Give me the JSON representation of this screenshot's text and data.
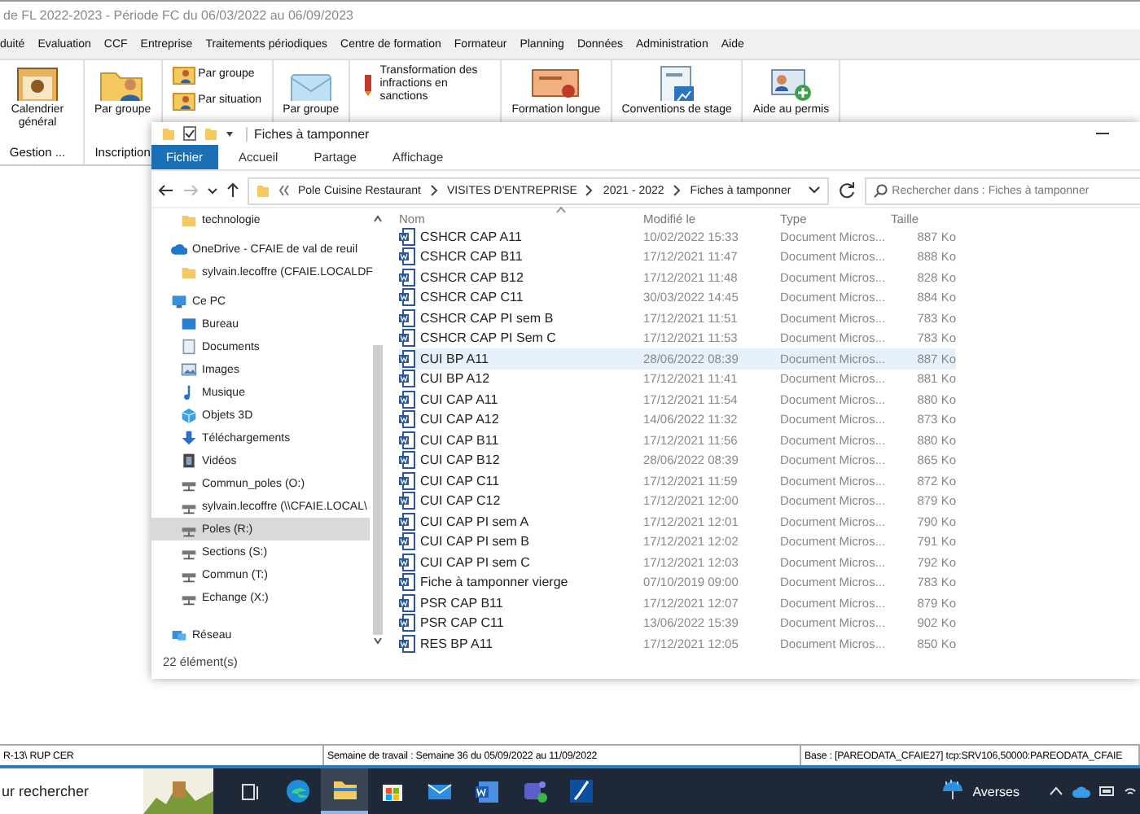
{
  "app": {
    "title": "de FL 2022-2023 - Période FC du 06/03/2022 au 06/09/2023",
    "menu": [
      "duité",
      "Evaluation",
      "CCF",
      "Entreprise",
      "Traitements périodiques",
      "Centre de formation",
      "Formateur",
      "Planning",
      "Données",
      "Administration",
      "Aide"
    ],
    "ribbon": [
      {
        "group": "Gestion ...",
        "items": [
          {
            "kind": "large",
            "label": "Calendrier général"
          }
        ]
      },
      {
        "group": "Inscription",
        "items": [
          {
            "kind": "large",
            "label": "Par groupe"
          }
        ]
      },
      {
        "items": [
          {
            "kind": "small",
            "label": "Par groupe"
          },
          {
            "kind": "small",
            "label": "Par situation"
          }
        ]
      },
      {
        "items": [
          {
            "kind": "large",
            "label": "Par groupe"
          }
        ]
      },
      {
        "items": [
          {
            "kind": "small",
            "label": "Transformation des infractions en sanctions"
          }
        ]
      },
      {
        "items": [
          {
            "kind": "large",
            "label": "Formation longue"
          }
        ]
      },
      {
        "items": [
          {
            "kind": "large",
            "label": "Conventions de stage"
          }
        ]
      },
      {
        "items": [
          {
            "kind": "large",
            "label": "Aide au permis"
          }
        ]
      }
    ]
  },
  "explorer": {
    "title": "Fiches à tamponner",
    "tabs": [
      {
        "label": "Fichier",
        "selected": true
      },
      {
        "label": "Accueil",
        "selected": false
      },
      {
        "label": "Partage",
        "selected": false
      },
      {
        "label": "Affichage",
        "selected": false
      }
    ],
    "breadcrumb": [
      "Pole Cuisine Restaurant",
      "VISITES D'ENTREPRISE",
      "2021 - 2022",
      "Fiches à tamponner"
    ],
    "search": {
      "placeholder": "Rechercher dans : Fiches à tamponner"
    },
    "nav": {
      "scrolled_parent_children": [
        {
          "label": "technologie",
          "kind": "folder",
          "selected": false
        }
      ],
      "items": [
        {
          "label": "OneDrive - CFAIE de val de reuil",
          "kind": "cloud",
          "selected": false,
          "children": [
            {
              "label": "sylvain.lecoffre (CFAIE.LOCALDF",
              "kind": "folder",
              "selected": false
            }
          ]
        },
        {
          "label": "Ce PC",
          "kind": "pc",
          "selected": false,
          "children": [
            {
              "label": "Bureau",
              "kind": "desktop",
              "selected": false
            },
            {
              "label": "Documents",
              "kind": "documents",
              "selected": false
            },
            {
              "label": "Images",
              "kind": "images",
              "selected": false
            },
            {
              "label": "Musique",
              "kind": "music",
              "selected": false
            },
            {
              "label": "Objets 3D",
              "kind": "cube",
              "selected": false
            },
            {
              "label": "Téléchargements",
              "kind": "download",
              "selected": false
            },
            {
              "label": "Vidéos",
              "kind": "video",
              "selected": false
            },
            {
              "label": "Commun_poles (O:)",
              "kind": "drive",
              "selected": false
            },
            {
              "label": "sylvain.lecoffre (\\\\CFAIE.LOCAL\\",
              "kind": "drive",
              "selected": false
            },
            {
              "label": "Poles (R:)",
              "kind": "drive",
              "selected": true
            },
            {
              "label": "Sections (S:)",
              "kind": "drive",
              "selected": false
            },
            {
              "label": "Commun (T:)",
              "kind": "drive",
              "selected": false
            },
            {
              "label": "Echange (X:)",
              "kind": "drive",
              "selected": false
            }
          ]
        },
        {
          "label": "Réseau",
          "kind": "network",
          "selected": false
        }
      ]
    },
    "columns": [
      "Nom",
      "Modifié le",
      "Type",
      "Taille"
    ],
    "files": [
      {
        "name": "CSHCR CAP A11",
        "modified": "10/02/2022 15:33",
        "type": "Document Micros...",
        "size": "887 Ko",
        "selected": false
      },
      {
        "name": "CSHCR CAP B11",
        "modified": "17/12/2021 11:47",
        "type": "Document Micros...",
        "size": "888 Ko",
        "selected": false
      },
      {
        "name": "CSHCR CAP B12",
        "modified": "17/12/2021 11:48",
        "type": "Document Micros...",
        "size": "828 Ko",
        "selected": false
      },
      {
        "name": "CSHCR CAP C11",
        "modified": "30/03/2022 14:45",
        "type": "Document Micros...",
        "size": "884 Ko",
        "selected": false
      },
      {
        "name": "CSHCR CAP PI sem B",
        "modified": "17/12/2021 11:51",
        "type": "Document Micros...",
        "size": "783 Ko",
        "selected": false
      },
      {
        "name": "CSHCR CAP PI Sem C",
        "modified": "17/12/2021 11:53",
        "type": "Document Micros...",
        "size": "783 Ko",
        "selected": false
      },
      {
        "name": "CUI BP A11",
        "modified": "28/06/2022 08:39",
        "type": "Document Micros...",
        "size": "887 Ko",
        "selected": true
      },
      {
        "name": "CUI BP A12",
        "modified": "17/12/2021 11:41",
        "type": "Document Micros...",
        "size": "881 Ko",
        "selected": false
      },
      {
        "name": "CUI CAP A11",
        "modified": "17/12/2021 11:54",
        "type": "Document Micros...",
        "size": "880 Ko",
        "selected": false
      },
      {
        "name": "CUI CAP A12",
        "modified": "14/06/2022 11:32",
        "type": "Document Micros...",
        "size": "873 Ko",
        "selected": false
      },
      {
        "name": "CUI CAP B11",
        "modified": "17/12/2021 11:56",
        "type": "Document Micros...",
        "size": "880 Ko",
        "selected": false
      },
      {
        "name": "CUI CAP B12",
        "modified": "28/06/2022 08:39",
        "type": "Document Micros...",
        "size": "865 Ko",
        "selected": false
      },
      {
        "name": "CUI CAP C11",
        "modified": "17/12/2021 11:59",
        "type": "Document Micros...",
        "size": "872 Ko",
        "selected": false
      },
      {
        "name": "CUI CAP C12",
        "modified": "17/12/2021 12:00",
        "type": "Document Micros...",
        "size": "879 Ko",
        "selected": false
      },
      {
        "name": "CUI CAP PI sem A",
        "modified": "17/12/2021 12:01",
        "type": "Document Micros...",
        "size": "790 Ko",
        "selected": false
      },
      {
        "name": "CUI CAP PI sem B",
        "modified": "17/12/2021 12:02",
        "type": "Document Micros...",
        "size": "791 Ko",
        "selected": false
      },
      {
        "name": "CUI CAP PI sem C",
        "modified": "17/12/2021 12:03",
        "type": "Document Micros...",
        "size": "792 Ko",
        "selected": false
      },
      {
        "name": "Fiche à tamponner vierge",
        "modified": "07/10/2019 09:00",
        "type": "Document Micros...",
        "size": "783 Ko",
        "selected": false
      },
      {
        "name": "PSR CAP B11",
        "modified": "17/12/2021 12:07",
        "type": "Document Micros...",
        "size": "879 Ko",
        "selected": false
      },
      {
        "name": "PSR CAP C11",
        "modified": "13/06/2022 15:39",
        "type": "Document Micros...",
        "size": "902 Ko",
        "selected": false
      },
      {
        "name": "RES BP A11",
        "modified": "17/12/2021 12:05",
        "type": "Document Micros...",
        "size": "850 Ko",
        "selected": false
      }
    ],
    "item_count": "22 élément(s)"
  },
  "status_bar": [
    "R-13\\ RUP CER",
    "Semaine de travail : Semaine 36 du 05/09/2022 au 11/09/2022",
    "Base : [PAREODATA_CFAIE27] tcp:SRV106,50000:PAREODATA_CFAIE"
  ],
  "taskbar": {
    "search_placeholder": "ur rechercher",
    "apps": [
      {
        "kind": "taskview",
        "active": false
      },
      {
        "kind": "edge",
        "active": false
      },
      {
        "kind": "explorer",
        "active": true
      },
      {
        "kind": "store",
        "active": false
      },
      {
        "kind": "mail",
        "active": false
      },
      {
        "kind": "word",
        "active": false
      },
      {
        "kind": "teams",
        "active": false
      },
      {
        "kind": "swoosh",
        "active": false
      }
    ],
    "weather": "Averses"
  }
}
